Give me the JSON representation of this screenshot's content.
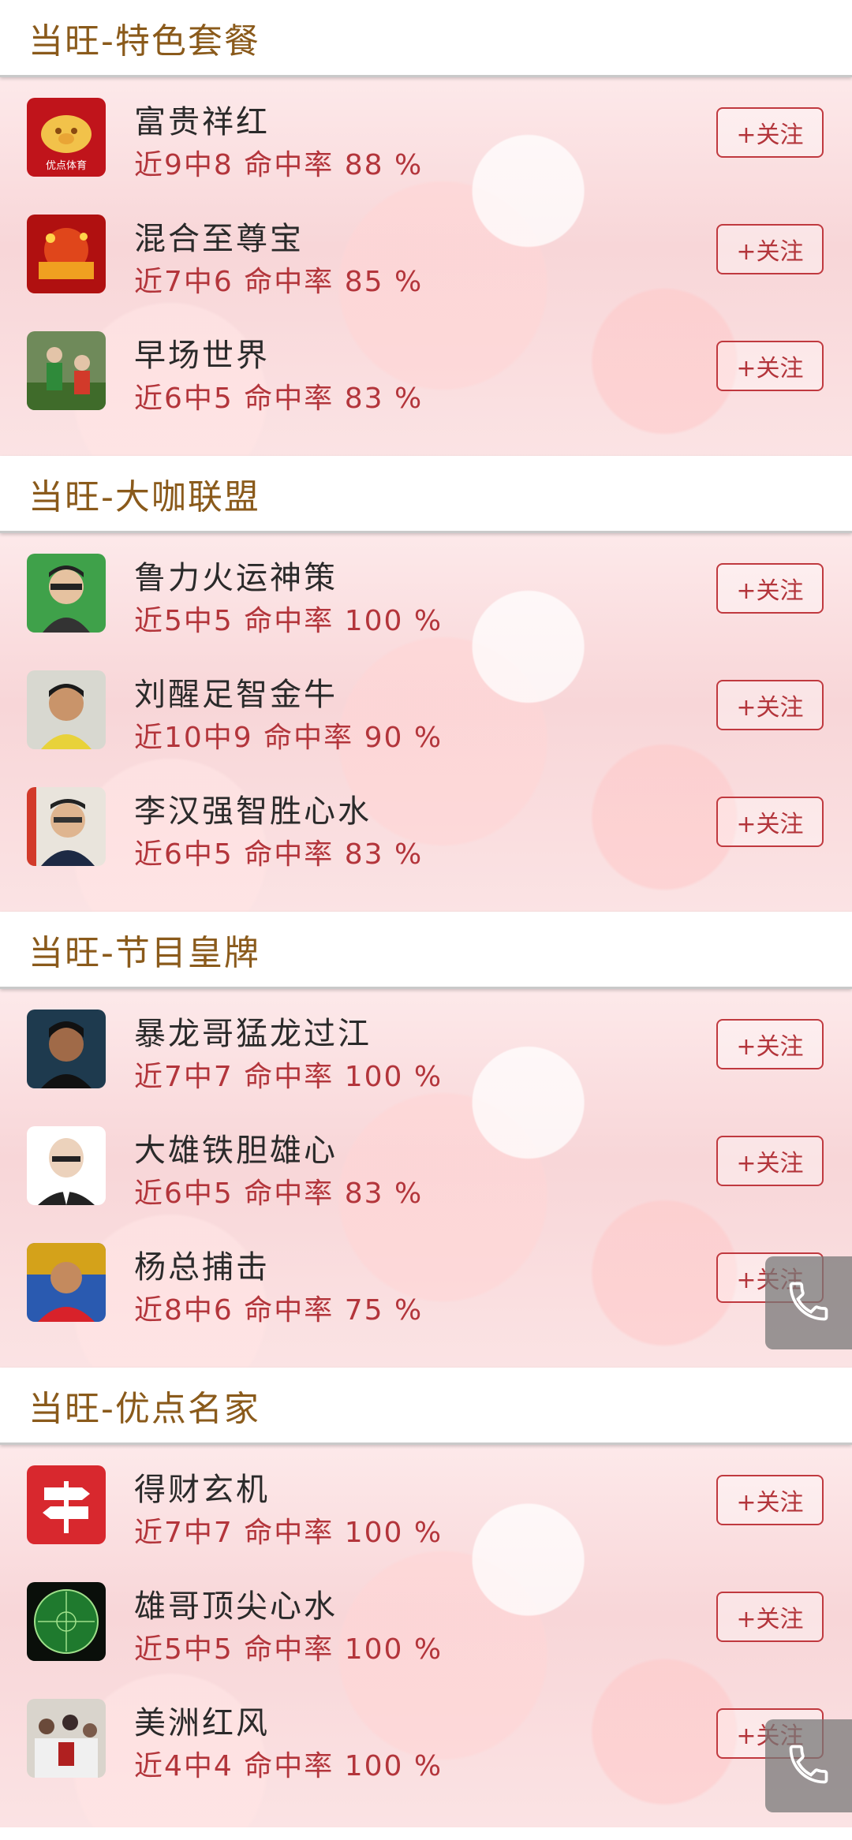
{
  "sections": [
    {
      "title": "当旺-特色套餐",
      "items": [
        {
          "name": "富贵祥红",
          "stats": "近9中8 命中率 88 %",
          "follow": "+关注",
          "avatar": "pig-logo-icon"
        },
        {
          "name": "混合至尊宝",
          "stats": "近7中6 命中率 85 %",
          "follow": "+关注",
          "avatar": "festive-photo-icon"
        },
        {
          "name": "早场世界",
          "stats": "近6中5 命中率 83 %",
          "follow": "+关注",
          "avatar": "goalkeeper-photo-icon"
        }
      ]
    },
    {
      "title": "当旺-大咖联盟",
      "items": [
        {
          "name": "鲁力火运神策",
          "stats": "近5中5 命中率 100 %",
          "follow": "+关注",
          "avatar": "man-glasses-photo-icon"
        },
        {
          "name": "刘醒足智金牛",
          "stats": "近10中9 命中率 90 %",
          "follow": "+关注",
          "avatar": "man-photo-icon"
        },
        {
          "name": "李汉强智胜心水",
          "stats": "近6中5 命中率 83 %",
          "follow": "+关注",
          "avatar": "man-suit-photo-icon"
        }
      ]
    },
    {
      "title": "当旺-节目皇牌",
      "items": [
        {
          "name": "暴龙哥猛龙过江",
          "stats": "近7中7 命中率 100 %",
          "follow": "+关注",
          "avatar": "man-dark-photo-icon"
        },
        {
          "name": "大雄铁胆雄心",
          "stats": "近6中5 命中率 83 %",
          "follow": "+关注",
          "avatar": "bald-man-photo-icon"
        },
        {
          "name": "杨总捕击",
          "stats": "近8中6 命中率 75 %",
          "follow": "+关注",
          "avatar": "man-red-jersey-photo-icon"
        }
      ]
    },
    {
      "title": "当旺-优点名家",
      "items": [
        {
          "name": "得财玄机",
          "stats": "近7中7 命中率 100 %",
          "follow": "+关注",
          "avatar": "signpost-icon"
        },
        {
          "name": "雄哥顶尖心水",
          "stats": "近5中5 命中率 100 %",
          "follow": "+关注",
          "avatar": "green-ball-icon"
        },
        {
          "name": "美洲红风",
          "stats": "近4中4 命中率 100 %",
          "follow": "+关注",
          "avatar": "crowd-photo-icon"
        }
      ]
    }
  ],
  "pig_logo_text": "优点体育",
  "floating_button": {
    "icon": "phone-icon"
  },
  "colors": {
    "header_text": "#8a5a1b",
    "stats_text": "#b3353b",
    "name_text": "#2a2a2a",
    "button_border": "#c0393f",
    "section_bg": "#f9dcdd"
  }
}
